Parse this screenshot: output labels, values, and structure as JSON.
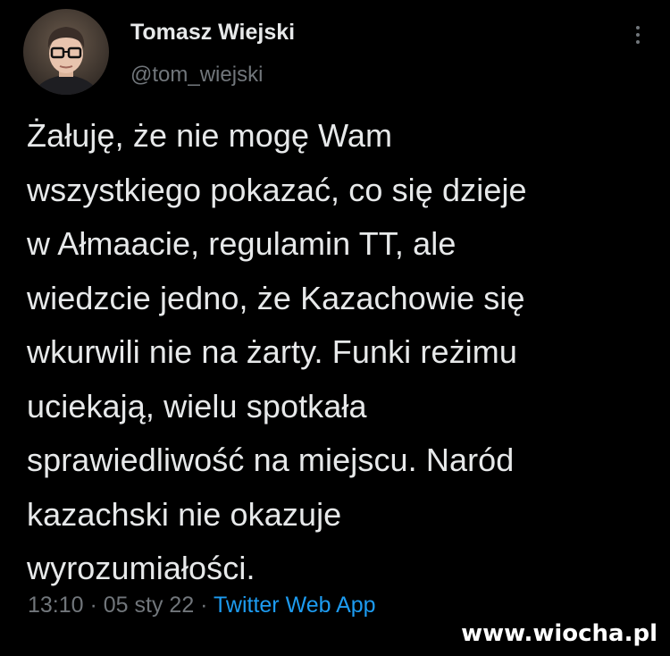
{
  "author": {
    "display_name": "Tomasz Wiejski",
    "handle": "@tom_wiejski",
    "avatar": "profile-photo"
  },
  "menu": {
    "icon": "more-vertical-icon"
  },
  "tweet": {
    "lines": [
      "Żałuję, że nie mogę Wam",
      "wszystkiego pokazać, co się dzieje",
      "w Ałmaacie, regulamin TT, ale",
      "wiedzcie jedno, że Kazachowie się",
      "wkurwili nie na żarty. Funki reżimu",
      "uciekają, wielu spotkała",
      "sprawiedliwość na miejscu. Naród",
      "kazachski nie okazuje",
      "wyrozumiałości."
    ]
  },
  "meta": {
    "time": "13:10",
    "separator": " · ",
    "date": "05 sty 22",
    "source": "Twitter Web App"
  },
  "watermark": "www.wiocha.pl",
  "colors": {
    "background": "#000000",
    "text": "#e7e9ea",
    "secondary": "#71767b",
    "link": "#1d9bf0"
  }
}
